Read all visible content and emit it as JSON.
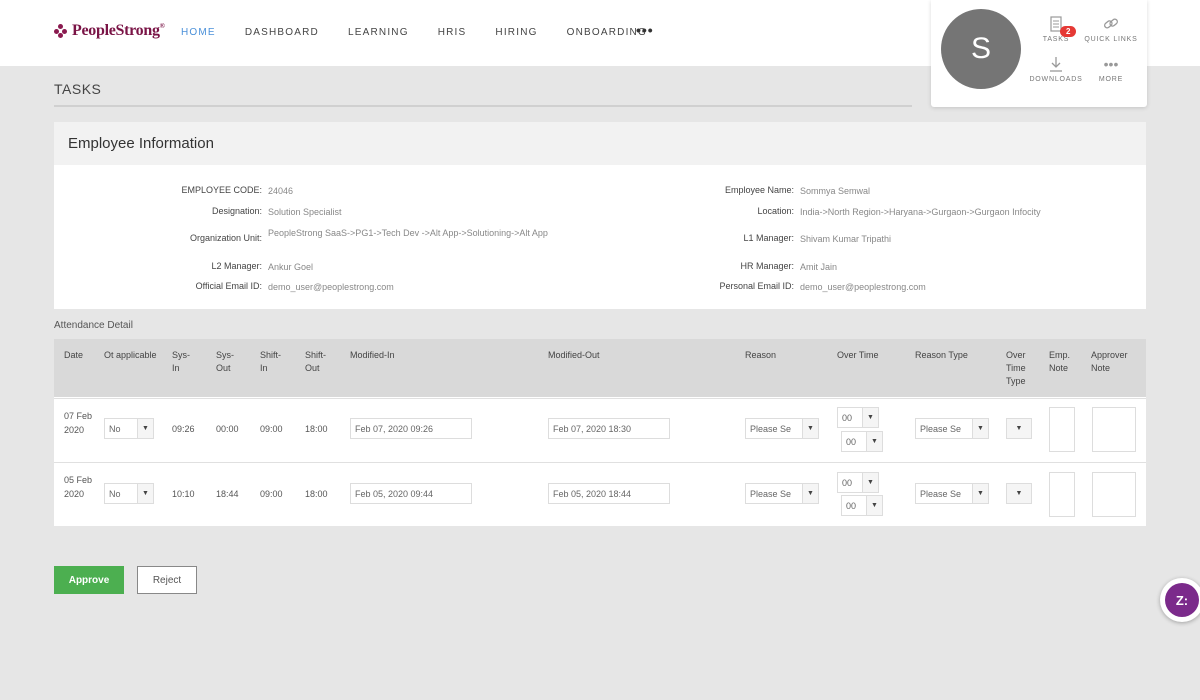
{
  "brand": {
    "name": "PeopleStrong",
    "mark": "®"
  },
  "nav": {
    "items": [
      "HOME",
      "DASHBOARD",
      "LEARNING",
      "HRIS",
      "HIRING",
      "ONBOARDING"
    ],
    "more": "•••"
  },
  "user": {
    "initial": "S",
    "tasks_label": "TASKS",
    "tasks_count": "2",
    "quicklinks_label": "QUICK LINKS",
    "downloads_label": "DOWNLOADS",
    "more_label": "MORE"
  },
  "page": {
    "title": "TASKS"
  },
  "employee": {
    "section_title": "Employee Information",
    "code_label": "EMPLOYEE CODE:",
    "code": "24046",
    "designation_label": "Designation:",
    "designation": "Solution Specialist",
    "org_label": "Organization Unit:",
    "org": "PeopleStrong SaaS->PG1->Tech Dev ->Alt App->Solutioning->Alt App",
    "l2_label": "L2 Manager:",
    "l2": "Ankur Goel",
    "email_label": "Official Email ID:",
    "email": "demo_user@peoplestrong.com",
    "name_label": "Employee Name:",
    "name": "Sommya Semwal",
    "location_label": "Location:",
    "location": "India->North Region->Haryana->Gurgaon->Gurgaon Infocity",
    "l1_label": "L1 Manager:",
    "l1": "Shivam Kumar Tripathi",
    "hr_label": "HR Manager:",
    "hr": "Amit Jain",
    "pemail_label": "Personal Email ID:",
    "pemail": "demo_user@peoplestrong.com"
  },
  "attendance": {
    "title": "Attendance Detail",
    "headers": {
      "date": "Date",
      "ot": "Ot applicable",
      "sysin": "Sys-In",
      "sysout": "Sys-Out",
      "shiftin": "Shift-In",
      "shiftout": "Shift-Out",
      "modin": "Modified-In",
      "modout": "Modified-Out",
      "reason": "Reason",
      "overtime": "Over Time",
      "reasontype": "Reason Type",
      "ottype": "Over Time Type",
      "empnote": "Emp. Note",
      "apprnote": "Approver Note"
    },
    "rows": [
      {
        "date": "07 Feb 2020",
        "ot": "No",
        "sysin": "09:26",
        "sysout": "00:00",
        "shiftin": "09:00",
        "shiftout": "18:00",
        "modin": "Feb 07, 2020 09:26",
        "modout": "Feb 07, 2020 18:30",
        "reason": "Please Se",
        "ot_h": "00",
        "ot_m": "00",
        "reasontype": "Please Se"
      },
      {
        "date": "05 Feb 2020",
        "ot": "No",
        "sysin": "10:10",
        "sysout": "18:44",
        "shiftin": "09:00",
        "shiftout": "18:00",
        "modin": "Feb 05, 2020 09:44",
        "modout": "Feb 05, 2020 18:44",
        "reason": "Please Se",
        "ot_h": "00",
        "ot_m": "00",
        "reasontype": "Please Se"
      }
    ]
  },
  "actions": {
    "approve": "Approve",
    "reject": "Reject"
  },
  "chat": {
    "label": "Z:"
  }
}
